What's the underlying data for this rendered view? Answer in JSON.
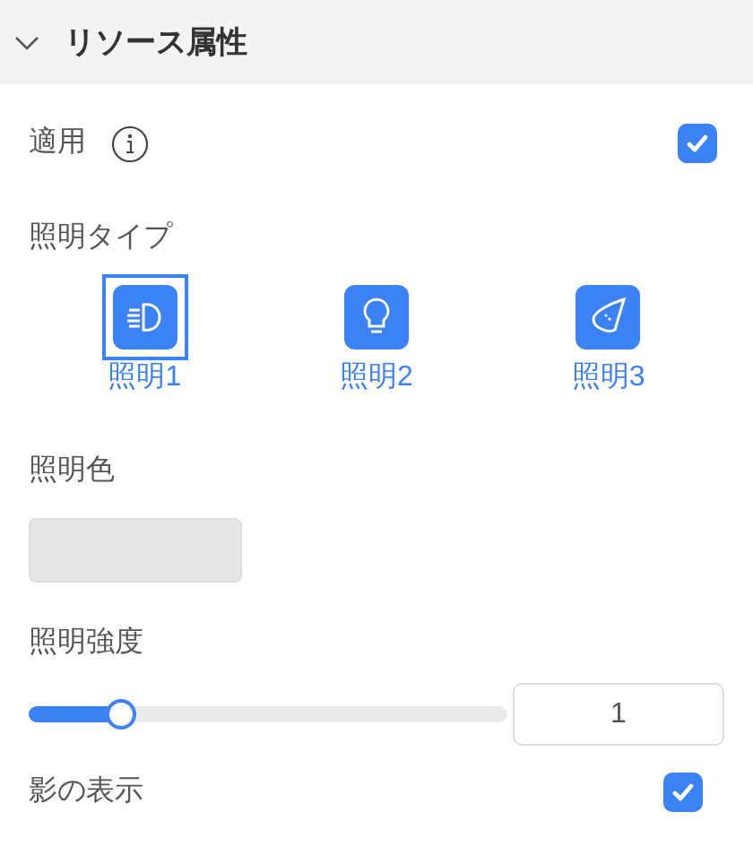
{
  "section": {
    "title": "リソース属性",
    "expanded": true
  },
  "apply": {
    "label": "適用",
    "checked": true
  },
  "light_type": {
    "label": "照明タイプ",
    "options": [
      {
        "label": "照明1",
        "kind": "headlight",
        "selected": true
      },
      {
        "label": "照明2",
        "kind": "bulb",
        "selected": false
      },
      {
        "label": "照明3",
        "kind": "spot",
        "selected": false
      }
    ]
  },
  "light_color": {
    "label": "照明色",
    "color": "#e6e6e6"
  },
  "intensity": {
    "label": "照明強度",
    "level": 0.19,
    "value": "1"
  },
  "shadow": {
    "label": "影の表示",
    "checked": true
  }
}
